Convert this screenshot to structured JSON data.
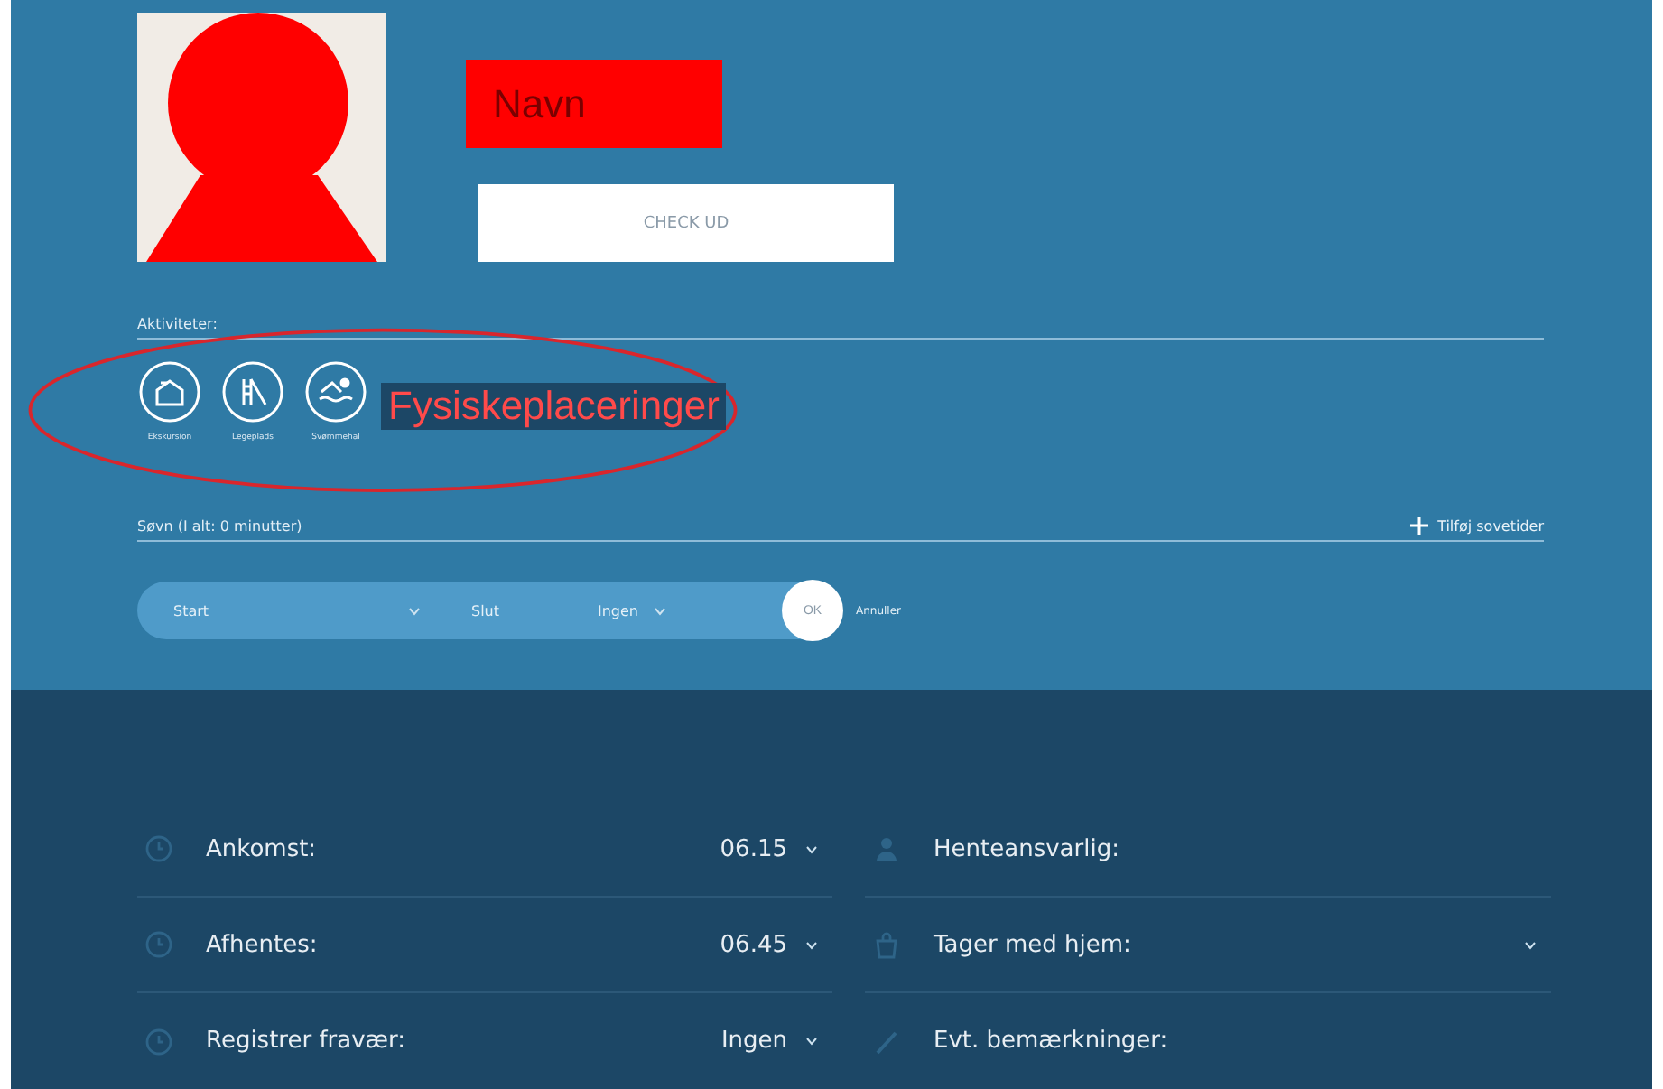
{
  "profile": {
    "name": "Navn",
    "checkout_button": "CHECK UD"
  },
  "activities": {
    "label": "Aktiviteter:",
    "items": [
      {
        "label": "Ekskursion",
        "kind": "shelter"
      },
      {
        "label": "Legeplads",
        "kind": "slide"
      },
      {
        "label": "Svømmehal",
        "kind": "swim"
      }
    ]
  },
  "annotation": {
    "text": "Fysiskeplaceringer"
  },
  "sleep": {
    "label": "Søvn (I alt: 0 minutter)",
    "add_button": "Tilføj sovetider",
    "start": "Start",
    "end": "Slut",
    "end_value": "Ingen",
    "ok_button": "OK",
    "cancel_link": "Annuller"
  },
  "details": {
    "left": [
      {
        "label": "Ankomst:",
        "value": "06.15",
        "kind": "clock"
      },
      {
        "label": "Afhentes:",
        "value": "06.45",
        "kind": "clock"
      },
      {
        "label": "Registrer fravær:",
        "value": "Ingen",
        "kind": "clock"
      }
    ],
    "right": [
      {
        "label": "Henteansvarlig:",
        "kind": "person",
        "dropdown": false
      },
      {
        "label": "Tager med hjem:",
        "kind": "bag",
        "dropdown": true
      },
      {
        "label": "Evt. bemærkninger:",
        "kind": "pencil",
        "dropdown": false
      }
    ]
  }
}
